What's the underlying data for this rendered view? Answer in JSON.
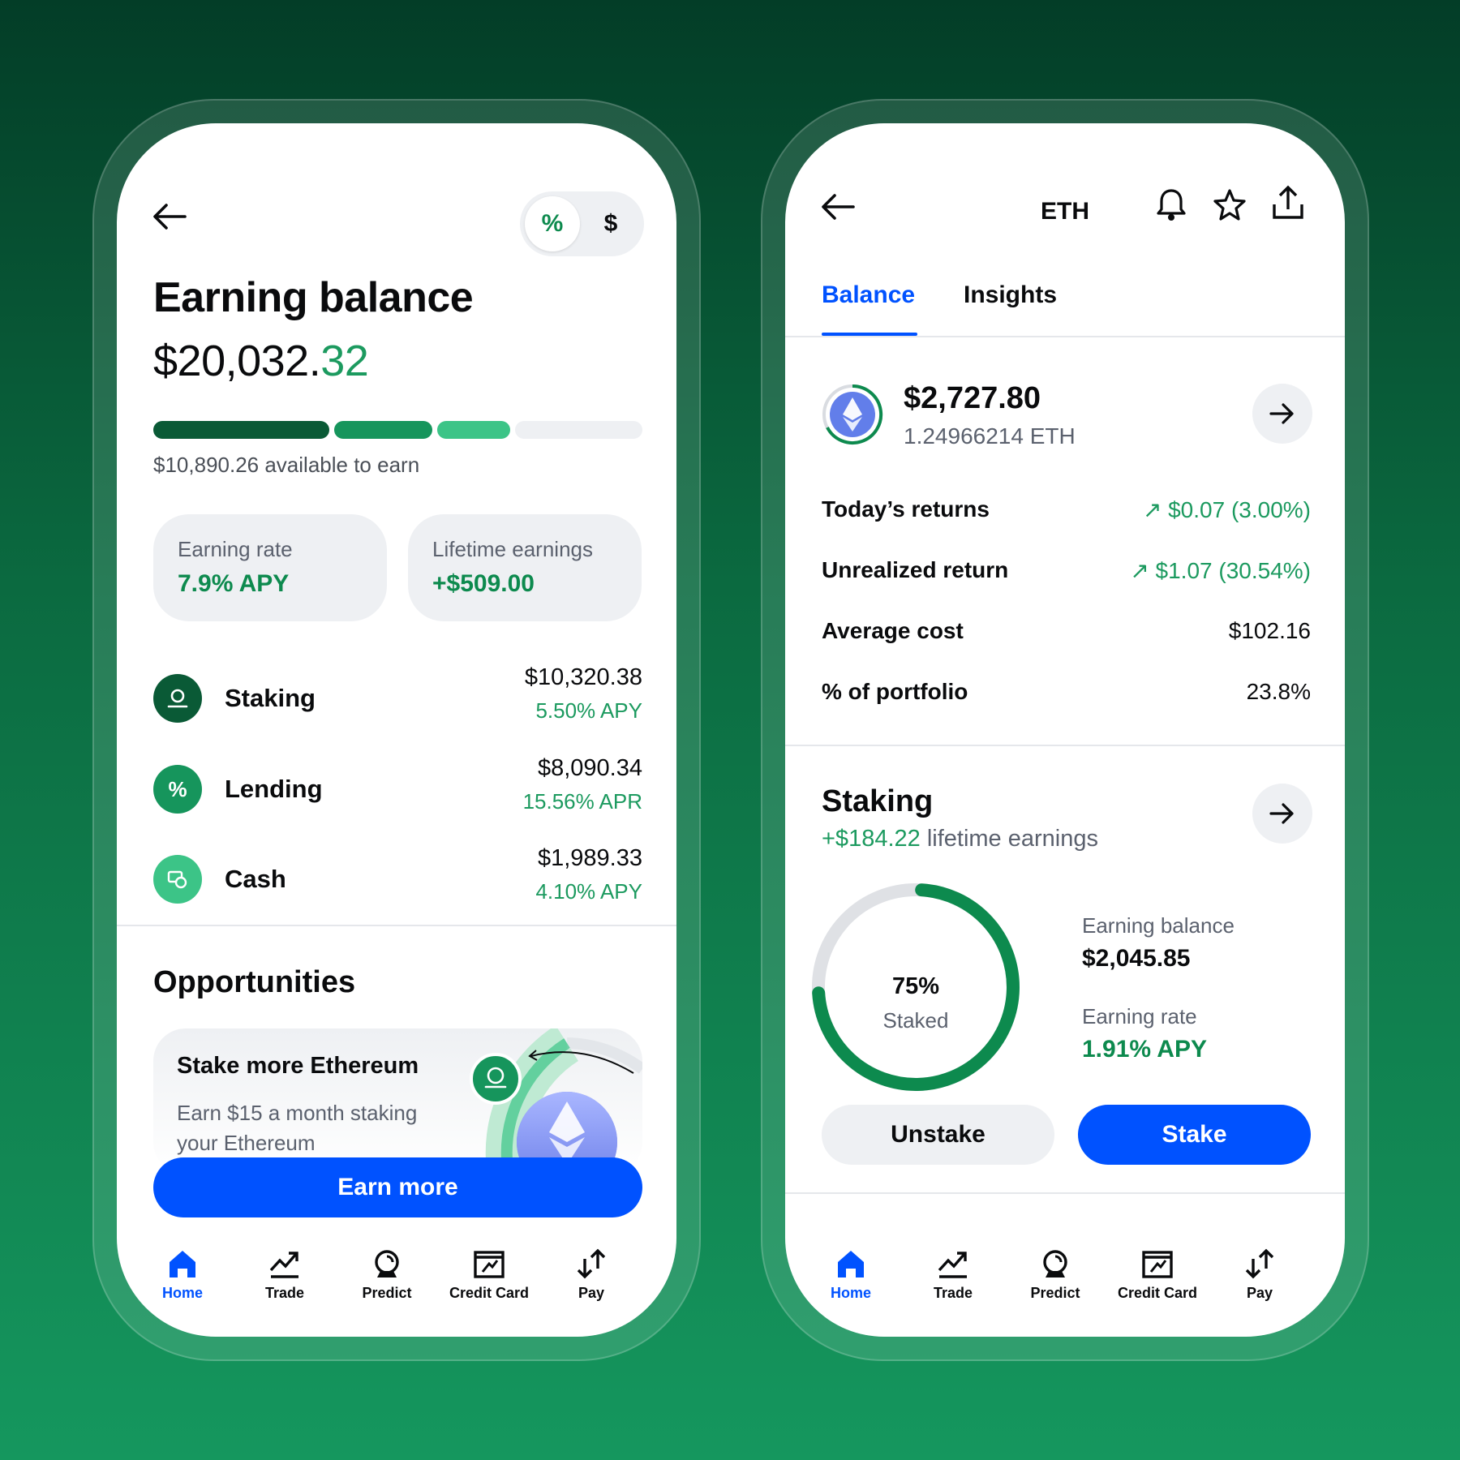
{
  "left_phone": {
    "toggle": {
      "percent_label": "%",
      "dollar_label": "$"
    },
    "title": "Earning balance",
    "amount_main": "$20,032.",
    "amount_cents": "32",
    "progress": {
      "segments": [
        0.36,
        0.2,
        0.15
      ],
      "colors": [
        "#0a5a36",
        "#16955c",
        "#3cc487",
        "#eef0f3"
      ]
    },
    "available": "$10,890.26 available to earn",
    "cards": [
      {
        "label": "Earning rate",
        "value": "7.9% APY"
      },
      {
        "label": "Lifetime earnings",
        "value": "+$509.00"
      }
    ],
    "products": [
      {
        "name": "Staking",
        "amount": "$10,320.38",
        "rate": "5.50% APY",
        "icon": "staking-icon",
        "color": "#0a5a36"
      },
      {
        "name": "Lending",
        "amount": "$8,090.34",
        "rate": "15.56% APR",
        "icon": "percent-icon",
        "color": "#16955c"
      },
      {
        "name": "Cash",
        "amount": "$1,989.33",
        "rate": "4.10% APY",
        "icon": "cash-icon",
        "color": "#3cc487"
      }
    ],
    "opportunities": {
      "title": "Opportunities",
      "promo_title": "Stake more Ethereum",
      "promo_subtitle": "Earn $15 a month staking your Ethereum",
      "cta": "Earn more"
    }
  },
  "right_phone": {
    "header_title": "ETH",
    "tabs": [
      "Balance",
      "Insights"
    ],
    "active_tab": "Balance",
    "coin": {
      "value": "$2,727.80",
      "quantity": "1.24966214 ETH"
    },
    "stats": [
      {
        "label": "Today’s returns",
        "value": "$0.07 (3.00%)",
        "trend": "up"
      },
      {
        "label": "Unrealized return",
        "value": "$1.07 (30.54%)",
        "trend": "up"
      },
      {
        "label": "Average cost",
        "value": "$102.16",
        "trend": "none"
      },
      {
        "label": "% of portfolio",
        "value": "23.8%",
        "trend": "none"
      }
    ],
    "staking": {
      "title": "Staking",
      "lifetime_amount": "+$184.22",
      "lifetime_label": " lifetime earnings",
      "staked_fraction": 0.75,
      "donut_percent": "75%",
      "donut_label": "Staked",
      "earning_balance_label": "Earning balance",
      "earning_balance_value": "$2,045.85",
      "earning_rate_label": "Earning rate",
      "earning_rate_value": "1.91% APY",
      "unstake_label": "Unstake",
      "stake_label": "Stake"
    }
  },
  "tabbar": {
    "items": [
      "Home",
      "Trade",
      "Predict",
      "Credit Card",
      "Pay"
    ],
    "active": "Home"
  },
  "colors": {
    "accent_blue": "#0052ff",
    "positive_green": "#1c9a5f",
    "brand_green": "#0d8a4e"
  }
}
